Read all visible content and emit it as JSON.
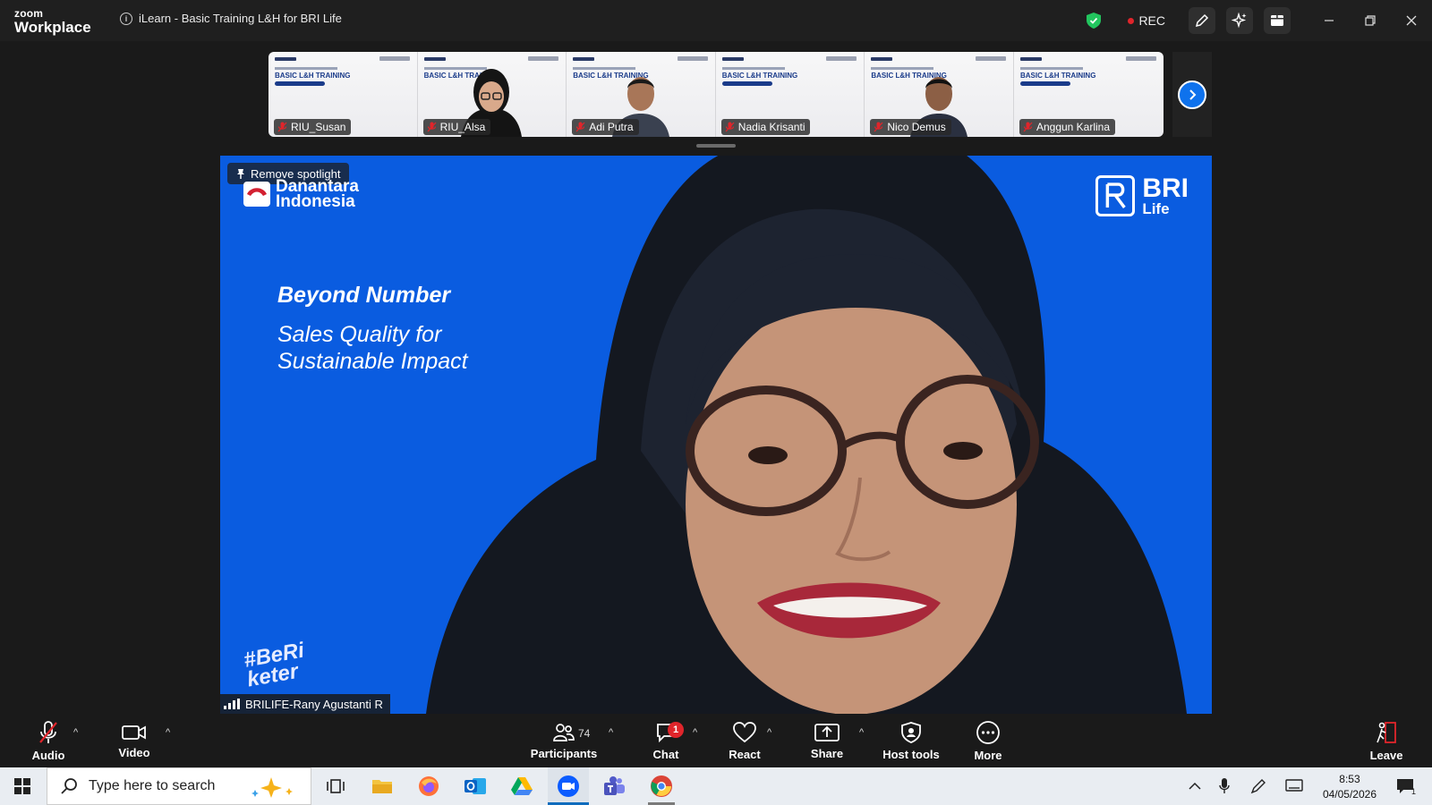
{
  "titlebar": {
    "brand_small": "zoom",
    "brand_large": "Workplace",
    "meeting_title": "iLearn - Basic Training L&H for BRI Life",
    "rec_label": "REC"
  },
  "gallery": {
    "slide_title": "BASIC L&H TRAINING",
    "participants": [
      {
        "name": "RIU_Susan",
        "has_video": false
      },
      {
        "name": "RIU_Alsa",
        "has_video": true
      },
      {
        "name": "Adi Putra",
        "has_video": true
      },
      {
        "name": "Nadia Krisanti",
        "has_video": false
      },
      {
        "name": "Nico Demus",
        "has_video": true
      },
      {
        "name": "Anggun Karlina",
        "has_video": false
      }
    ]
  },
  "main_video": {
    "spotlight_label": "Remove spotlight",
    "logo_left_line1": "Danantara",
    "logo_left_line2": "Indonesia",
    "logo_right_line1": "BRI",
    "logo_right_line2": "Life",
    "headline": "Beyond Number",
    "subline1": "Sales Quality for",
    "subline2": "Sustainable Impact",
    "hashtag_line1": "#BeRi",
    "hashtag_line2": "keter",
    "speaker_name": "BRILIFE-Rany Agustanti R"
  },
  "toolbar": {
    "audio": "Audio",
    "video": "Video",
    "participants": "Participants",
    "participants_count": "74",
    "chat": "Chat",
    "chat_badge": "1",
    "react": "React",
    "share": "Share",
    "host_tools": "Host tools",
    "more": "More",
    "leave": "Leave"
  },
  "taskbar": {
    "search_placeholder": "Type here to search",
    "time": "8:53",
    "date": "04/05/2026",
    "notification_count": "1"
  },
  "colors": {
    "zoom_blue": "#0e72ed",
    "slide_blue": "#0a5ce0",
    "rec_red": "#e0252b",
    "shield_green": "#22c55e"
  }
}
